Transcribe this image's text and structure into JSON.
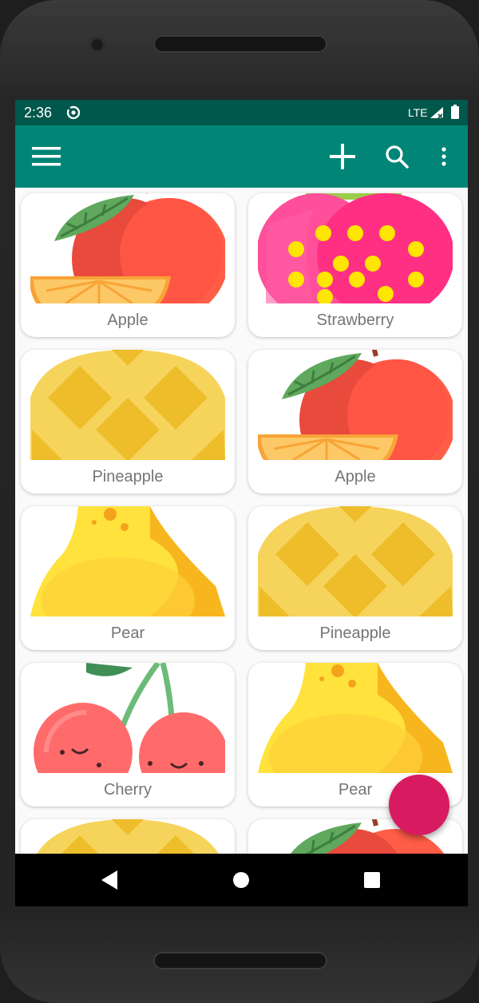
{
  "status_bar": {
    "time": "2:36",
    "network": "LTE"
  },
  "toolbar": {
    "menu_icon": "hamburger-menu-icon",
    "add_icon": "plus-icon",
    "search_icon": "search-icon",
    "overflow_icon": "more-vert-icon"
  },
  "colors": {
    "status_bar": "#00574b",
    "toolbar": "#008577",
    "fab": "#d81b60",
    "label_text": "#757575"
  },
  "grid": {
    "items": [
      {
        "label": "Apple",
        "image": "apple"
      },
      {
        "label": "Strawberry",
        "image": "strawberry"
      },
      {
        "label": "Pineapple",
        "image": "pineapple"
      },
      {
        "label": "Apple",
        "image": "apple"
      },
      {
        "label": "Pear",
        "image": "pear"
      },
      {
        "label": "Pineapple",
        "image": "pineapple"
      },
      {
        "label": "Cherry",
        "image": "cherry"
      },
      {
        "label": "Pear",
        "image": "pear"
      },
      {
        "label": "",
        "image": "pineapple"
      },
      {
        "label": "",
        "image": "apple"
      }
    ]
  },
  "fab": {
    "icon": "fab-button"
  },
  "nav_bar": {
    "back_icon": "back-triangle-icon",
    "home_icon": "home-circle-icon",
    "recents_icon": "recents-square-icon"
  }
}
